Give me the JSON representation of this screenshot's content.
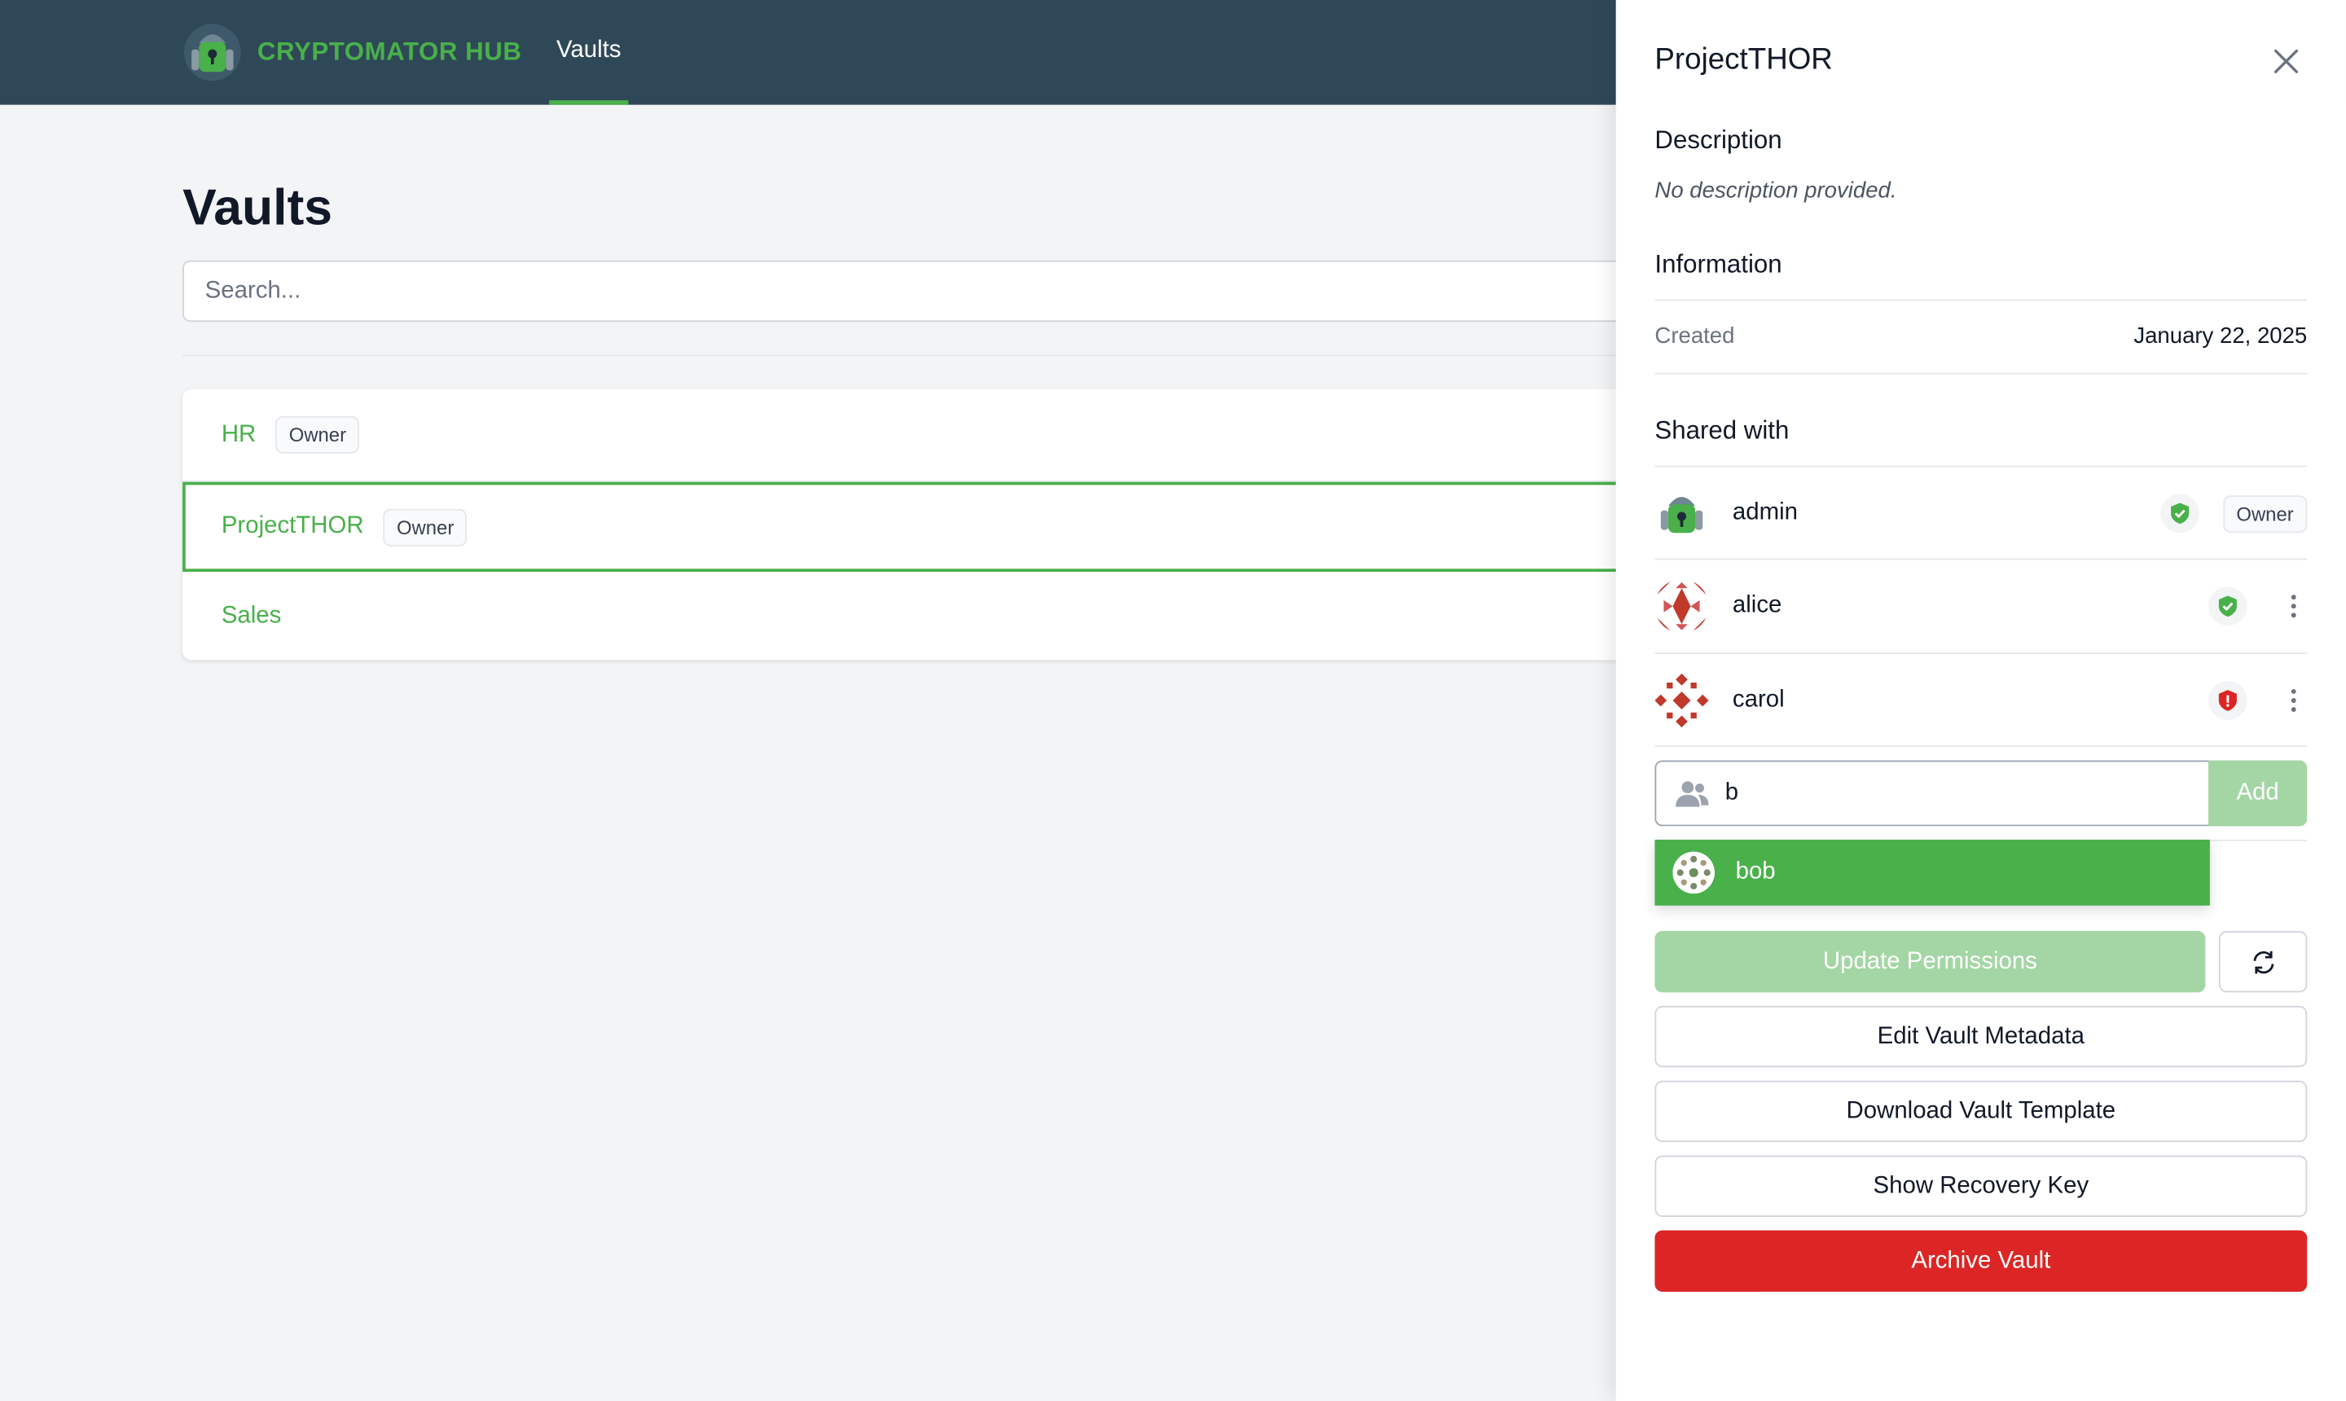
{
  "header": {
    "brand_name": "CRYPTOMATOR HUB",
    "nav_vaults": "Vaults"
  },
  "main": {
    "title": "Vaults",
    "search_placeholder": "Search...",
    "vaults": [
      {
        "name": "HR",
        "badge": "Owner"
      },
      {
        "name": "ProjectTHOR",
        "badge": "Owner",
        "selected": true
      },
      {
        "name": "Sales",
        "badge": ""
      }
    ]
  },
  "panel": {
    "title": "ProjectTHOR",
    "description_heading": "Description",
    "description_text": "No description provided.",
    "information_heading": "Information",
    "created_label": "Created",
    "created_value": "January 22, 2025",
    "shared_heading": "Shared with",
    "members": [
      {
        "name": "admin",
        "status": "trusted",
        "role": "Owner"
      },
      {
        "name": "alice",
        "status": "trusted",
        "role": ""
      },
      {
        "name": "carol",
        "status": "untrusted",
        "role": ""
      }
    ],
    "add_input_value": "b",
    "add_button": "Add",
    "suggestion": "bob",
    "update_permissions": "Update Permissions",
    "edit_metadata": "Edit Vault Metadata",
    "download_template": "Download Vault Template",
    "show_recovery": "Show Recovery Key",
    "archive": "Archive Vault"
  },
  "colors": {
    "brand_green": "#49b04a",
    "topbar": "#2f4858",
    "danger": "#dc2626",
    "disabled_green": "#a3d6a4"
  }
}
